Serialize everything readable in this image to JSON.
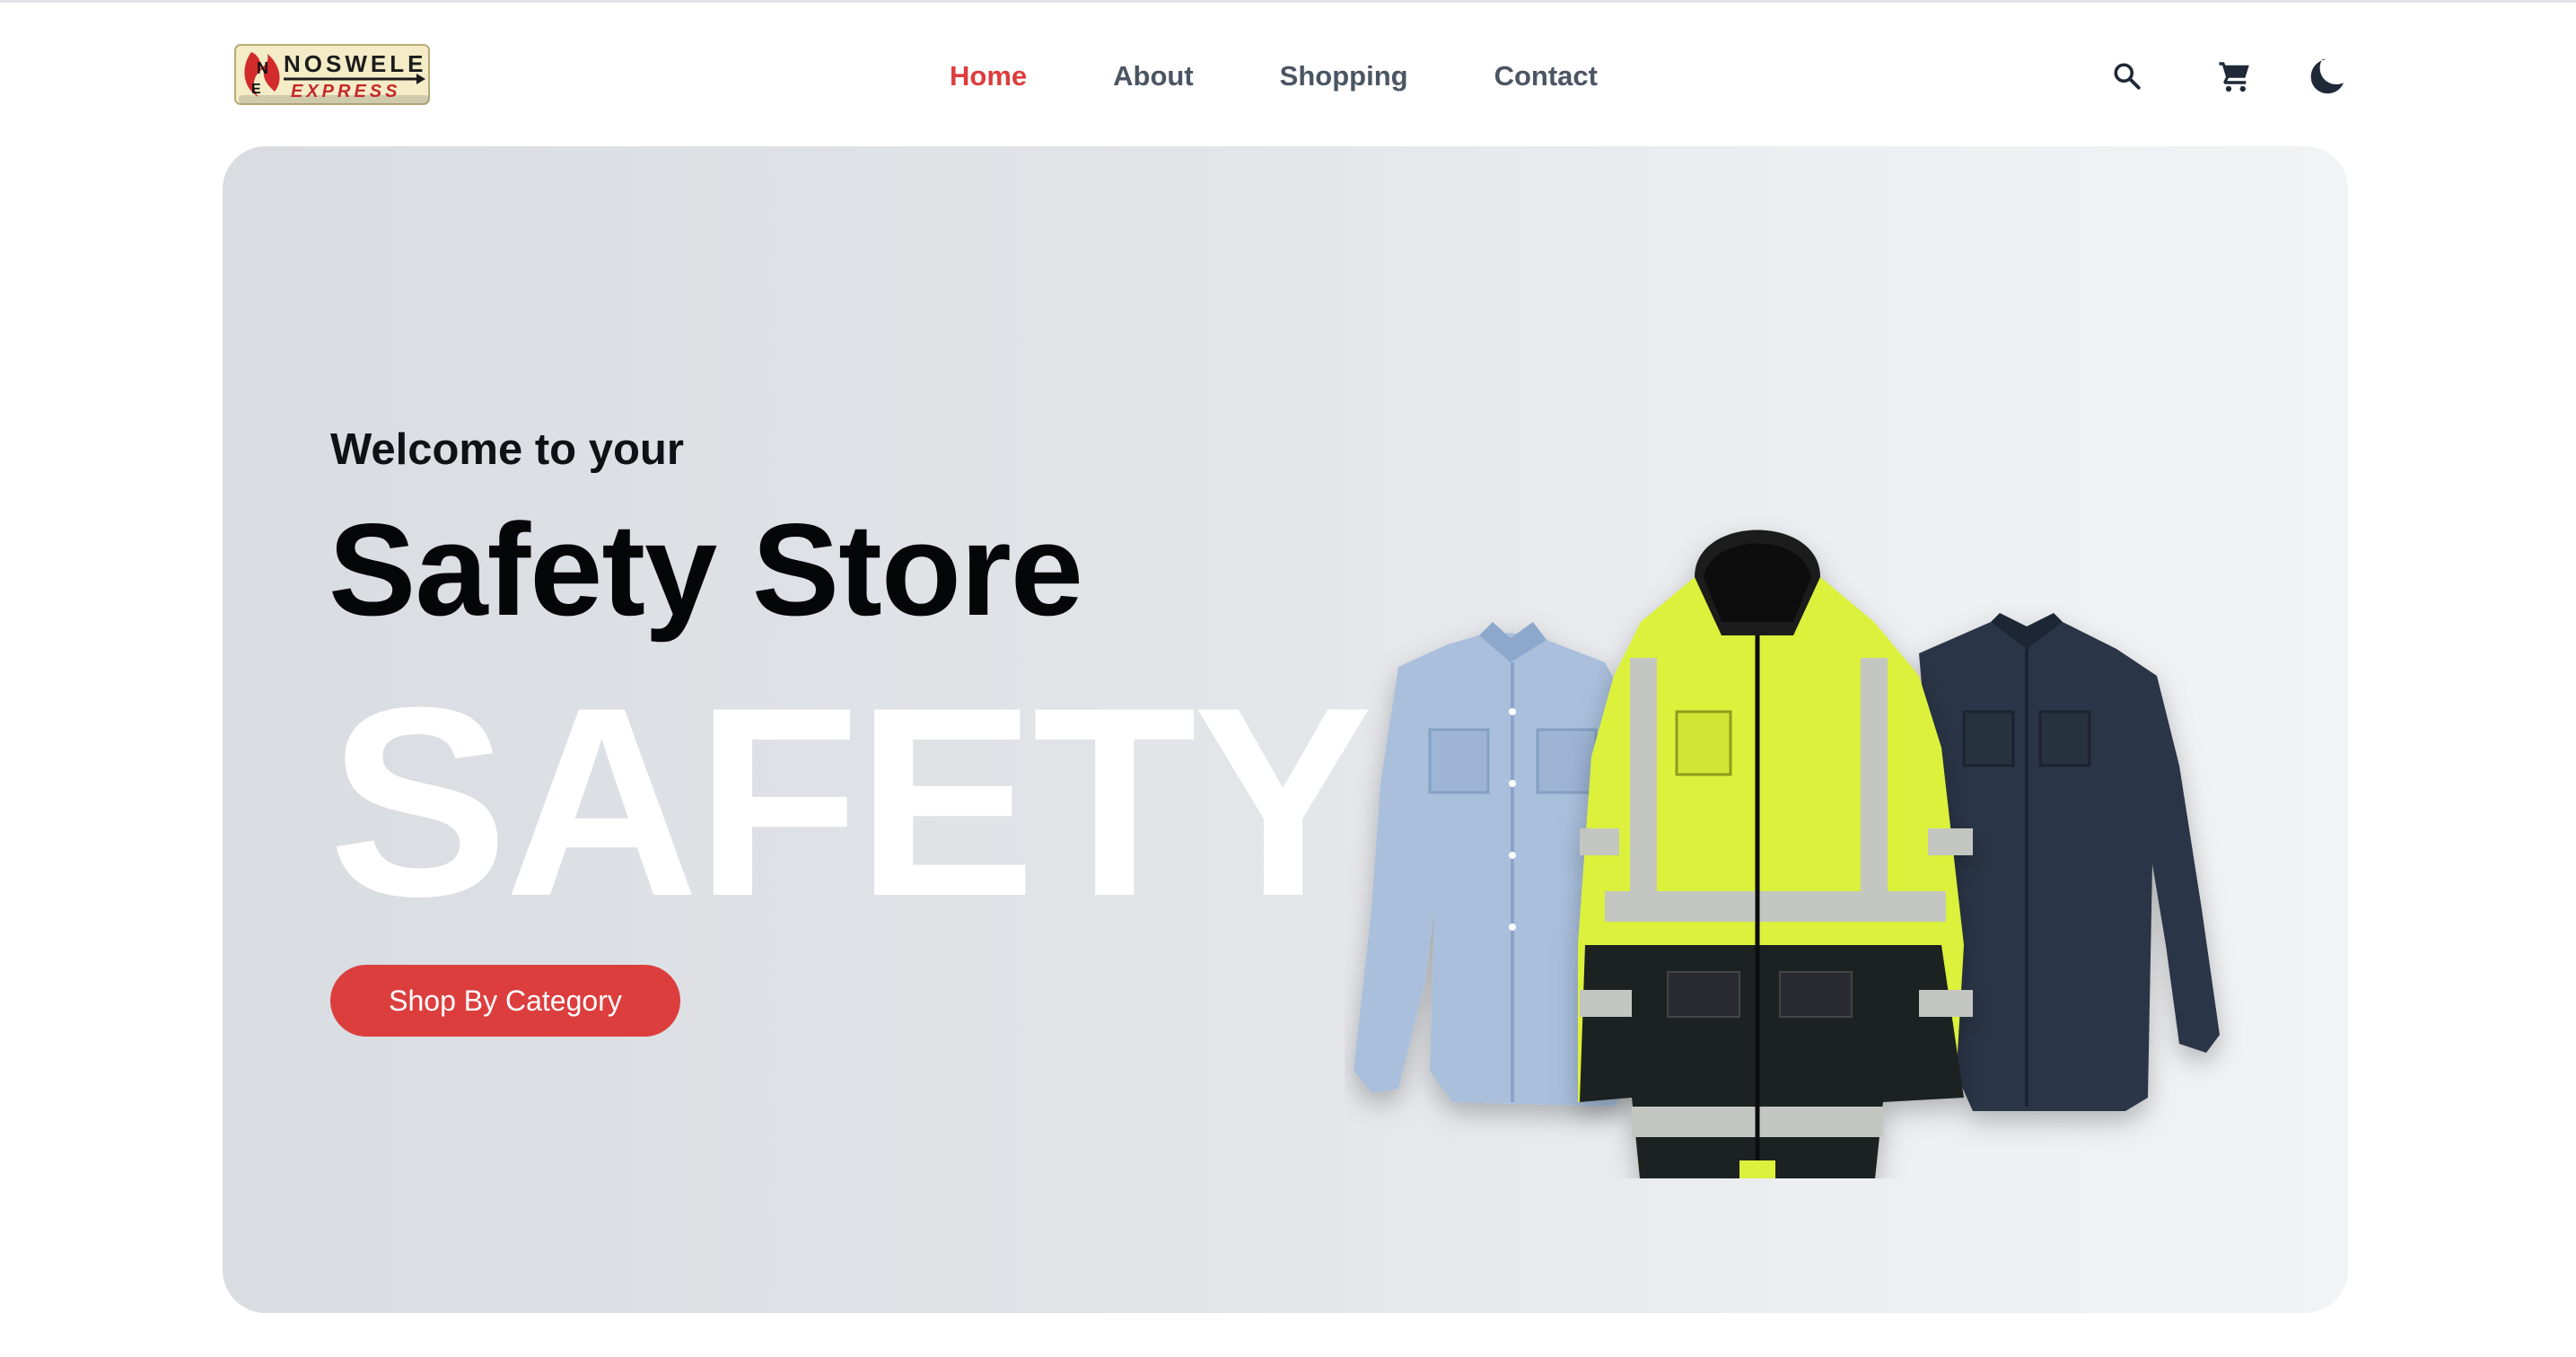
{
  "brand": {
    "logo_text_top": "NOSWELE",
    "logo_text_bottom": "EXPRESS",
    "logo_initial_1": "N",
    "logo_initial_2": "E"
  },
  "nav": {
    "items": [
      {
        "label": "Home",
        "active": true
      },
      {
        "label": "About",
        "active": false
      },
      {
        "label": "Shopping",
        "active": false
      },
      {
        "label": "Contact",
        "active": false
      }
    ]
  },
  "header_icons": {
    "search": "search-icon",
    "cart": "cart-icon",
    "theme": "moon-icon"
  },
  "hero": {
    "welcome": "Welcome to your",
    "title": "Safety Store",
    "watermark": "SAFETY",
    "cta_label": "Shop By Category"
  },
  "colors": {
    "accent": "#dc3e3e",
    "nav_text": "#4b5563",
    "hero_bg": "#e2e4e8"
  }
}
